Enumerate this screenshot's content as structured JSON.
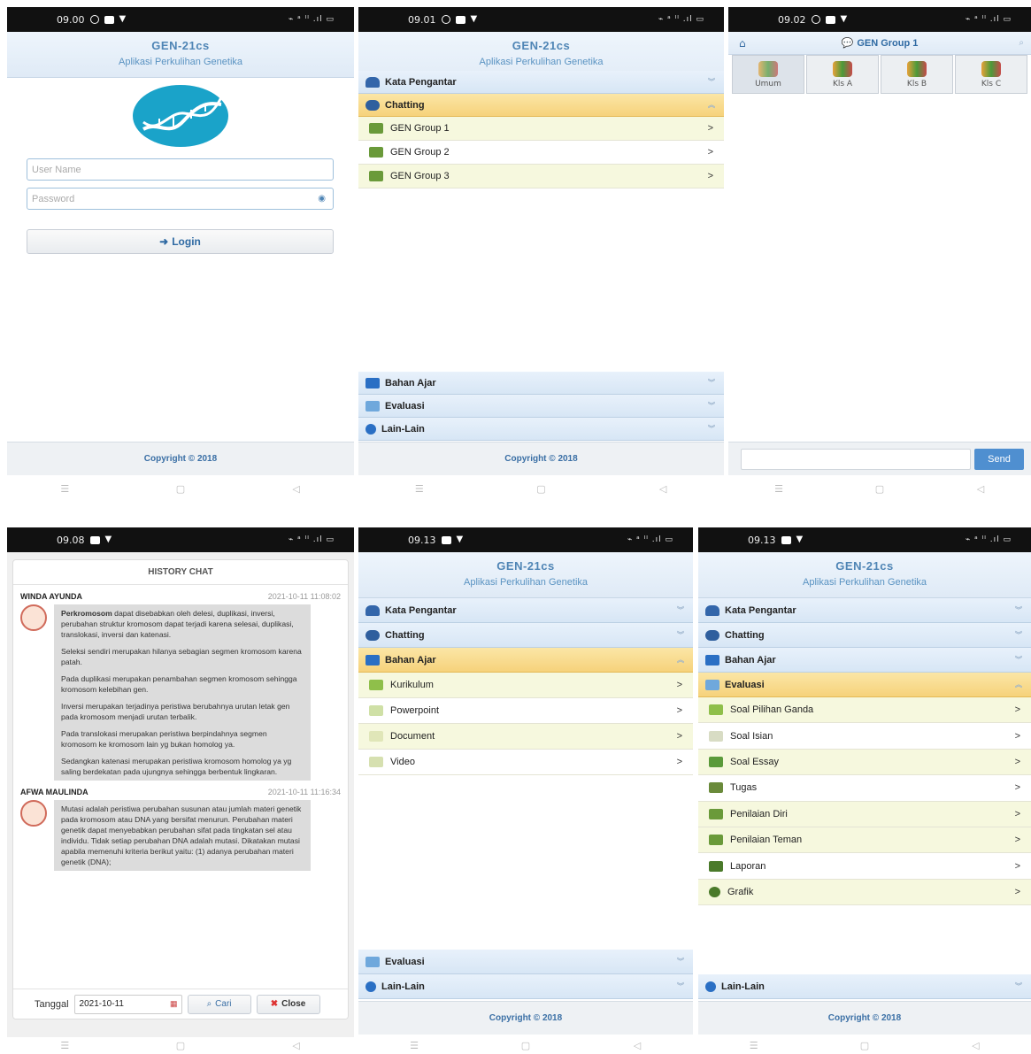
{
  "app": {
    "title": "GEN-21cs",
    "subtitle": "Aplikasi Perkulihan Genetika",
    "copyright": "Copyright © 2018"
  },
  "status": {
    "signal": "⌁ ᵃ ᴵᴵ .ıl ▭"
  },
  "screens": {
    "login": {
      "time": "09.00",
      "username_placeholder": "User Name",
      "password_placeholder": "Password",
      "login_label": "Login"
    },
    "menu": {
      "time": "09.01",
      "kata_pengantar": "Kata Pengantar",
      "chatting": "Chatting",
      "groups": [
        "GEN Group 1",
        "GEN Group 2",
        "GEN Group 3"
      ],
      "bahan_ajar": "Bahan Ajar",
      "evaluasi": "Evaluasi",
      "lain_lain": "Lain-Lain"
    },
    "group": {
      "time": "09.02",
      "title": "GEN Group 1",
      "tabs": [
        "Umum",
        "Kls A",
        "Kls B",
        "Kls C"
      ],
      "send_label": "Send"
    },
    "history": {
      "time": "09.08",
      "title": "HISTORY CHAT",
      "messages": [
        {
          "name": "WINDA AYUNDA",
          "time": "2021-10-11 11:08:02",
          "lead_bold": "Perkromosom",
          "lead_rest": " dapat disebabkan oleh delesi, duplikasi, inversi, perubahan struktur kromosom dapat terjadi karena selesai, duplikasi, translokasi, inversi dan katenasi.",
          "p2": "Seleksi sendiri merupakan hilanya sebagian segmen kromosom karena patah.",
          "p3": "Pada duplikasi merupakan penambahan segmen kromosom sehingga kromosom kelebihan gen.",
          "p4": "Inversi merupakan terjadinya peristiwa berubahnya urutan letak gen pada kromosom menjadi urutan terbalik.",
          "p5": "Pada translokasi merupakan peristiwa berpindahnya segmen kromosom ke kromosom lain yg bukan homolog ya.",
          "p6": "Sedangkan katenasi merupakan peristiwa kromosom homolog ya yg saling berdekatan pada ujungnya sehingga berbentuk lingkaran."
        },
        {
          "name": "AFWA MAULINDA",
          "time": "2021-10-11 11:16:34",
          "p1": "Mutasi adalah peristiwa perubahan susunan atau jumlah materi genetik pada kromosom atau DNA yang bersifat menurun. Perubahan materi genetik dapat menyebabkan perubahan sifat pada tingkatan sel atau individu. Tidak setiap perubahan DNA adalah mutasi. Dikatakan mutasi apabila memenuhi kriteria berikut yaitu: (1) adanya perubahan materi genetik (DNA);"
        }
      ],
      "date_label": "Tanggal",
      "date_value": "2021-10-11",
      "search_label": "Cari",
      "close_label": "Close"
    },
    "bahan": {
      "time": "09.13",
      "items": [
        "Kurikulum",
        "Powerpoint",
        "Document",
        "Video"
      ]
    },
    "evaluasi": {
      "time": "09.13",
      "items": [
        "Soal Pilihan Ganda",
        "Soal Isian",
        "Soal Essay",
        "Tugas",
        "Penilaian Diri",
        "Penilaian Teman",
        "Laporan",
        "Grafik"
      ]
    }
  }
}
